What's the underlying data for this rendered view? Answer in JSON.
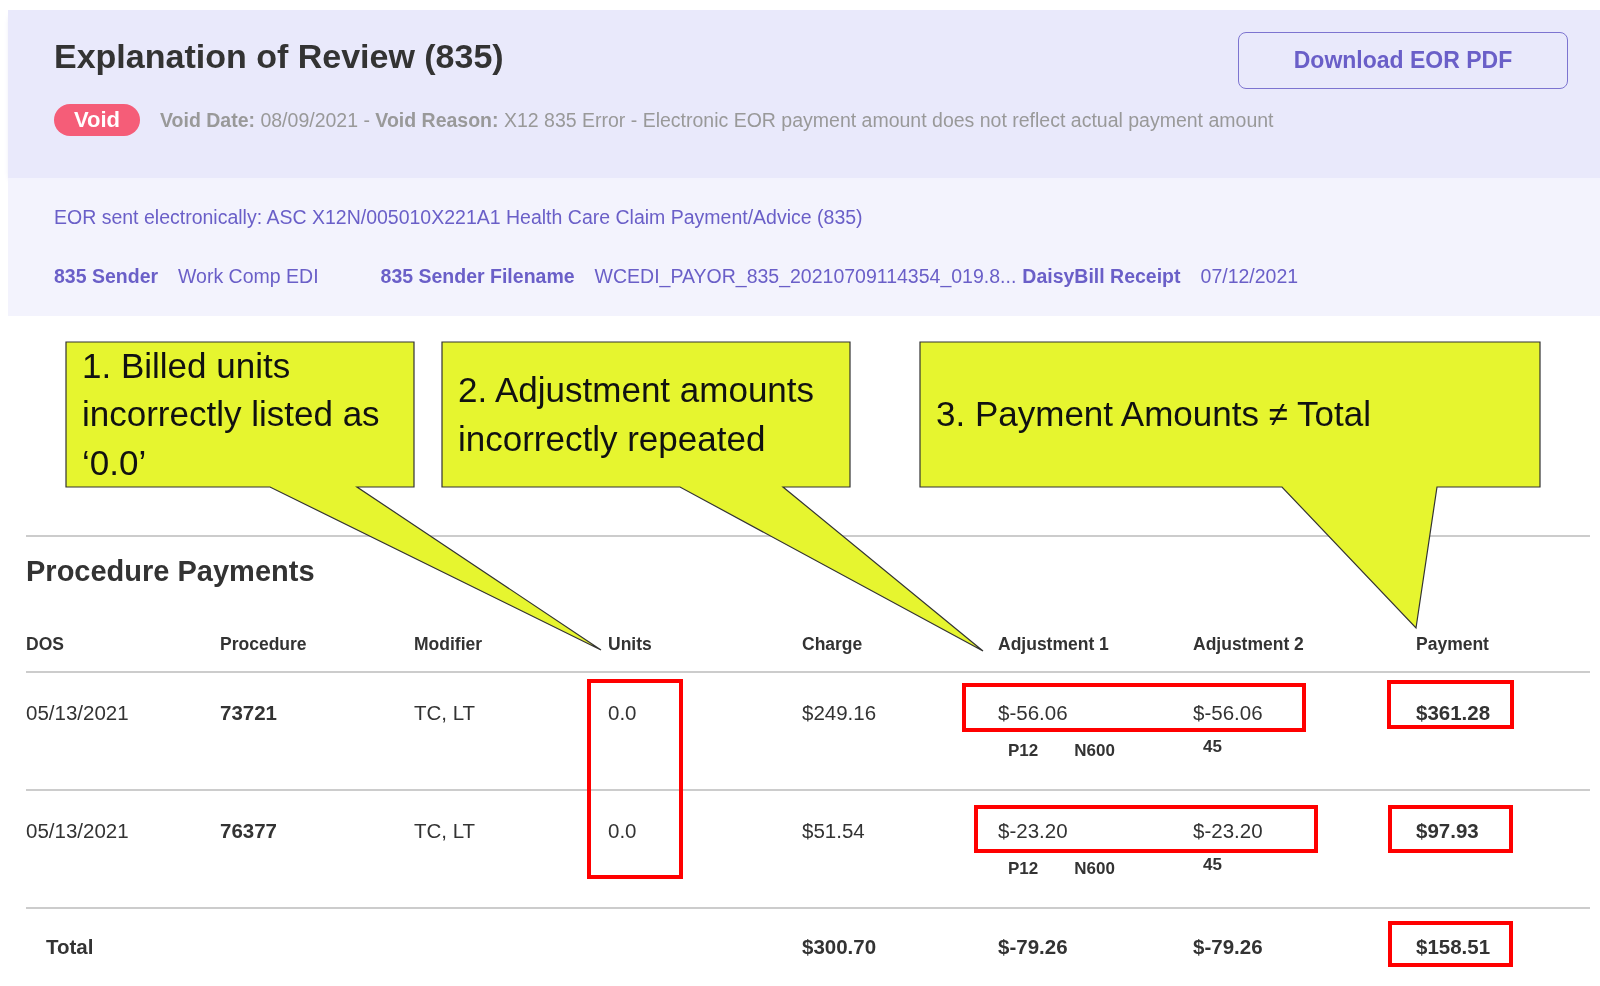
{
  "header": {
    "title": "Explanation of Review (835)",
    "download_button": "Download EOR PDF",
    "status_badge": "Void",
    "void_info": "**Void Date:** 08/09/2021 - **Void Reason:** X12 835 Error - Electronic EOR payment amount does not reflect actual payment amount"
  },
  "details": {
    "transmission": "EOR sent electronically: ASC X12N/005010X221A1 Health Care Claim Payment/Advice (835)",
    "fields": [
      {
        "label": "835 Sender",
        "value": "Work Comp EDI"
      },
      {
        "label": "835 Sender Filename",
        "value": "WCEDI_PAYOR_835_20210709114354_019.8..."
      },
      {
        "label": "DaisyBill Receipt",
        "value": "07/12/2021"
      }
    ]
  },
  "procedure_payments": {
    "title": "Procedure Payments",
    "columns": [
      "DOS",
      "Procedure",
      "Modifier",
      "Units",
      "Charge",
      "Adjustment 1",
      "Adjustment 2",
      "Payment"
    ],
    "rows": [
      {
        "dos": "05/13/2021",
        "procedure": "73721",
        "modifier": "TC, LT",
        "units": "0.0",
        "charge": "$249.16",
        "adjustment_1": {
          "amount": "$-56.06",
          "codes": [
            "P12",
            "N600"
          ]
        },
        "adjustment_2": {
          "amount": "$-56.06",
          "codes": [
            "45"
          ]
        },
        "payment": "$361.28"
      },
      {
        "dos": "05/13/2021",
        "procedure": "76377",
        "modifier": "TC, LT",
        "units": "0.0",
        "charge": "$51.54",
        "adjustment_1": {
          "amount": "$-23.20",
          "codes": [
            "P12",
            "N600"
          ]
        },
        "adjustment_2": {
          "amount": "$-23.20",
          "codes": [
            "45"
          ]
        },
        "payment": "$97.93"
      }
    ],
    "total": {
      "label": "Total",
      "charge": "$300.70",
      "adjustment_1": "$-79.26",
      "adjustment_2": "$-79.26",
      "payment": "$158.51"
    }
  },
  "annotations": [
    {
      "text": "1. Billed units incorrectly listed as ‘0.0’"
    },
    {
      "text": "2. Adjustment amounts incorrectly repeated"
    },
    {
      "text": "3. Payment Amounts ≠ Total"
    }
  ]
}
